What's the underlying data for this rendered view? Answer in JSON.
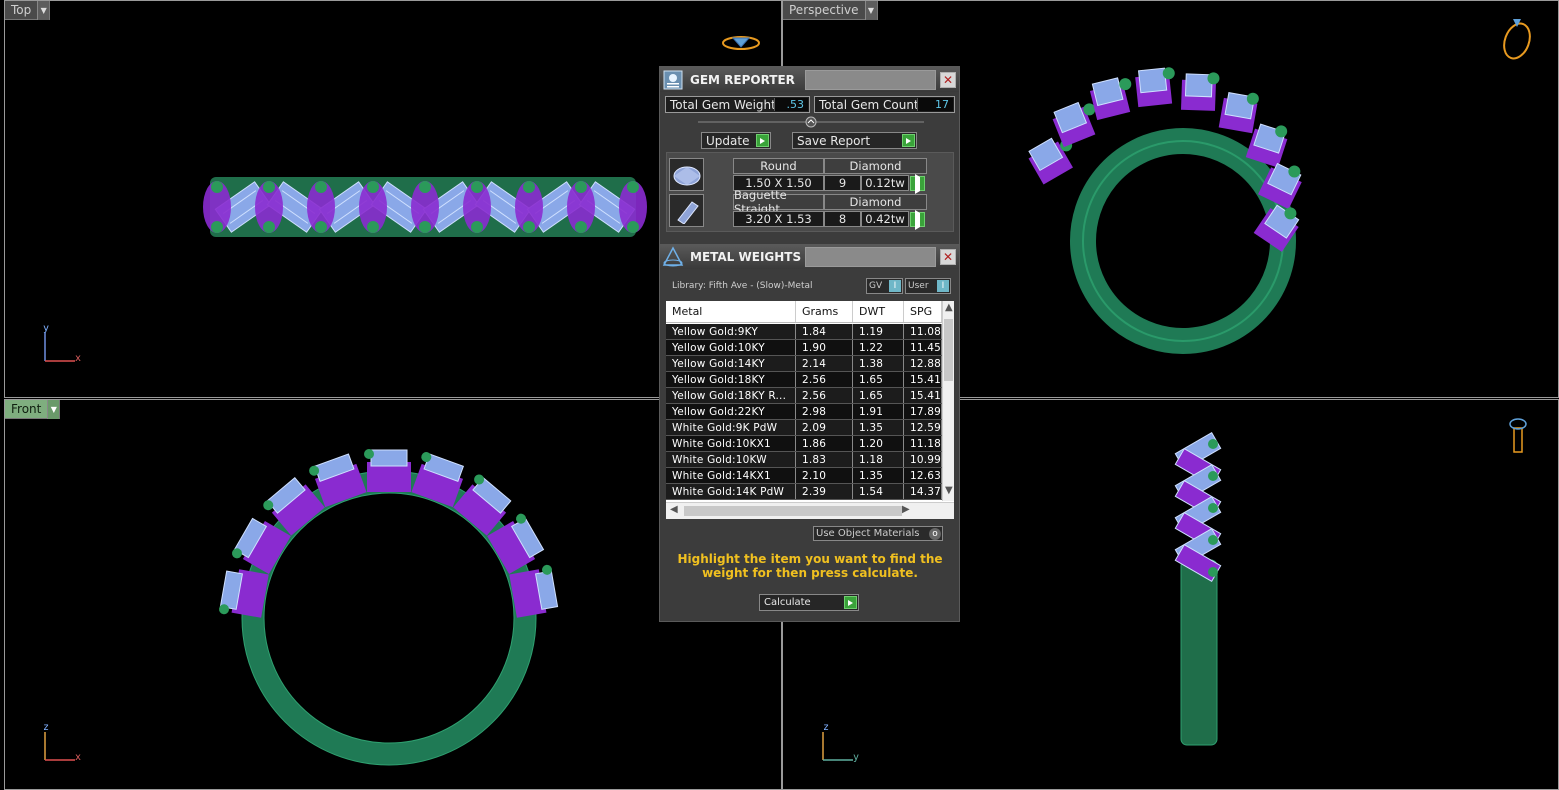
{
  "viewports": {
    "top": {
      "label": "Top",
      "axis_a": "y",
      "axis_b": "x"
    },
    "perspective": {
      "label": "Perspective"
    },
    "front": {
      "label": "Front",
      "axis_a": "z",
      "axis_b": "x"
    },
    "right": {
      "label": "",
      "axis_a": "z",
      "axis_b": "y"
    }
  },
  "gem_reporter": {
    "title": "GEM REPORTER",
    "total_weight_label": "Total Gem Weight",
    "total_weight_value": ".53",
    "total_count_label": "Total Gem Count",
    "total_count_value": "17",
    "update_label": "Update",
    "save_label": "Save Report",
    "gems": [
      {
        "shape": "Round",
        "material": "Diamond",
        "size": "1.50 X 1.50",
        "count": "9",
        "weight": "0.12tw"
      },
      {
        "shape": "Baguette Straight",
        "material": "Diamond",
        "size": "3.20 X 1.53",
        "count": "8",
        "weight": "0.42tw"
      }
    ]
  },
  "metal_weights": {
    "title": "METAL WEIGHTS",
    "library": "Library: Fifth Ave - (Slow)-Metal",
    "gv_label": "GV",
    "user_label": "User",
    "columns": [
      "Metal",
      "Grams",
      "DWT",
      "SPG"
    ],
    "rows": [
      [
        "Yellow Gold:9KY",
        "1.84",
        "1.19",
        "11.08"
      ],
      [
        "Yellow Gold:10KY",
        "1.90",
        "1.22",
        "11.45"
      ],
      [
        "Yellow Gold:14KY",
        "2.14",
        "1.38",
        "12.88"
      ],
      [
        "Yellow Gold:18KY",
        "2.56",
        "1.65",
        "15.41"
      ],
      [
        "Yellow Gold:18KY R...",
        "2.56",
        "1.65",
        "15.41"
      ],
      [
        "Yellow Gold:22KY",
        "2.98",
        "1.91",
        "17.89"
      ],
      [
        "White Gold:9K PdW",
        "2.09",
        "1.35",
        "12.59"
      ],
      [
        "White Gold:10KX1",
        "1.86",
        "1.20",
        "11.18"
      ],
      [
        "White Gold:10KW",
        "1.83",
        "1.18",
        "10.99"
      ],
      [
        "White Gold:14KX1",
        "2.10",
        "1.35",
        "12.63"
      ],
      [
        "White Gold:14K PdW",
        "2.39",
        "1.54",
        "14.37"
      ]
    ],
    "use_object_materials": "Use Object Materials",
    "hint": "Highlight the item you want to find the weight for then press calculate.",
    "calculate_label": "Calculate"
  }
}
